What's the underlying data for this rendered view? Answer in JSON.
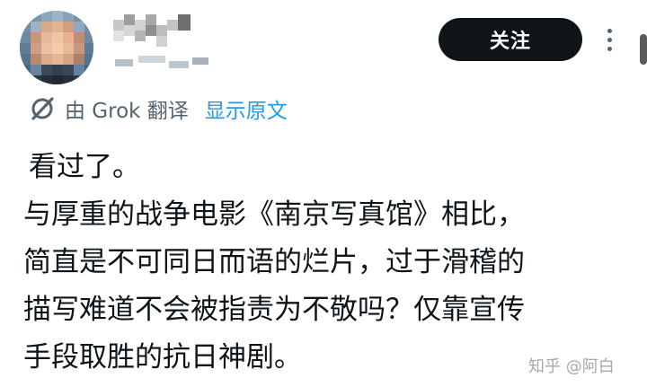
{
  "header": {
    "follow_label": "关注",
    "more_icon": "more-vertical-icon"
  },
  "translation": {
    "icon": "grok-icon",
    "translated_by": "由 Grok 翻译",
    "show_original": "显示原文"
  },
  "post": {
    "lines": [
      "看过了。",
      "与厚重的战争电影《南京写真馆》相比，",
      "简直是不可同日而语的烂片，过于滑稽的",
      "描写难道不会被指责为不敬吗？仅靠宣传",
      "手段取胜的抗日神剧。"
    ]
  },
  "watermark": "知乎 @阿白",
  "colors": {
    "text": "#0f1419",
    "secondary": "#536471",
    "link": "#1d9bf0",
    "button_bg": "#0f1419",
    "button_text": "#ffffff"
  }
}
